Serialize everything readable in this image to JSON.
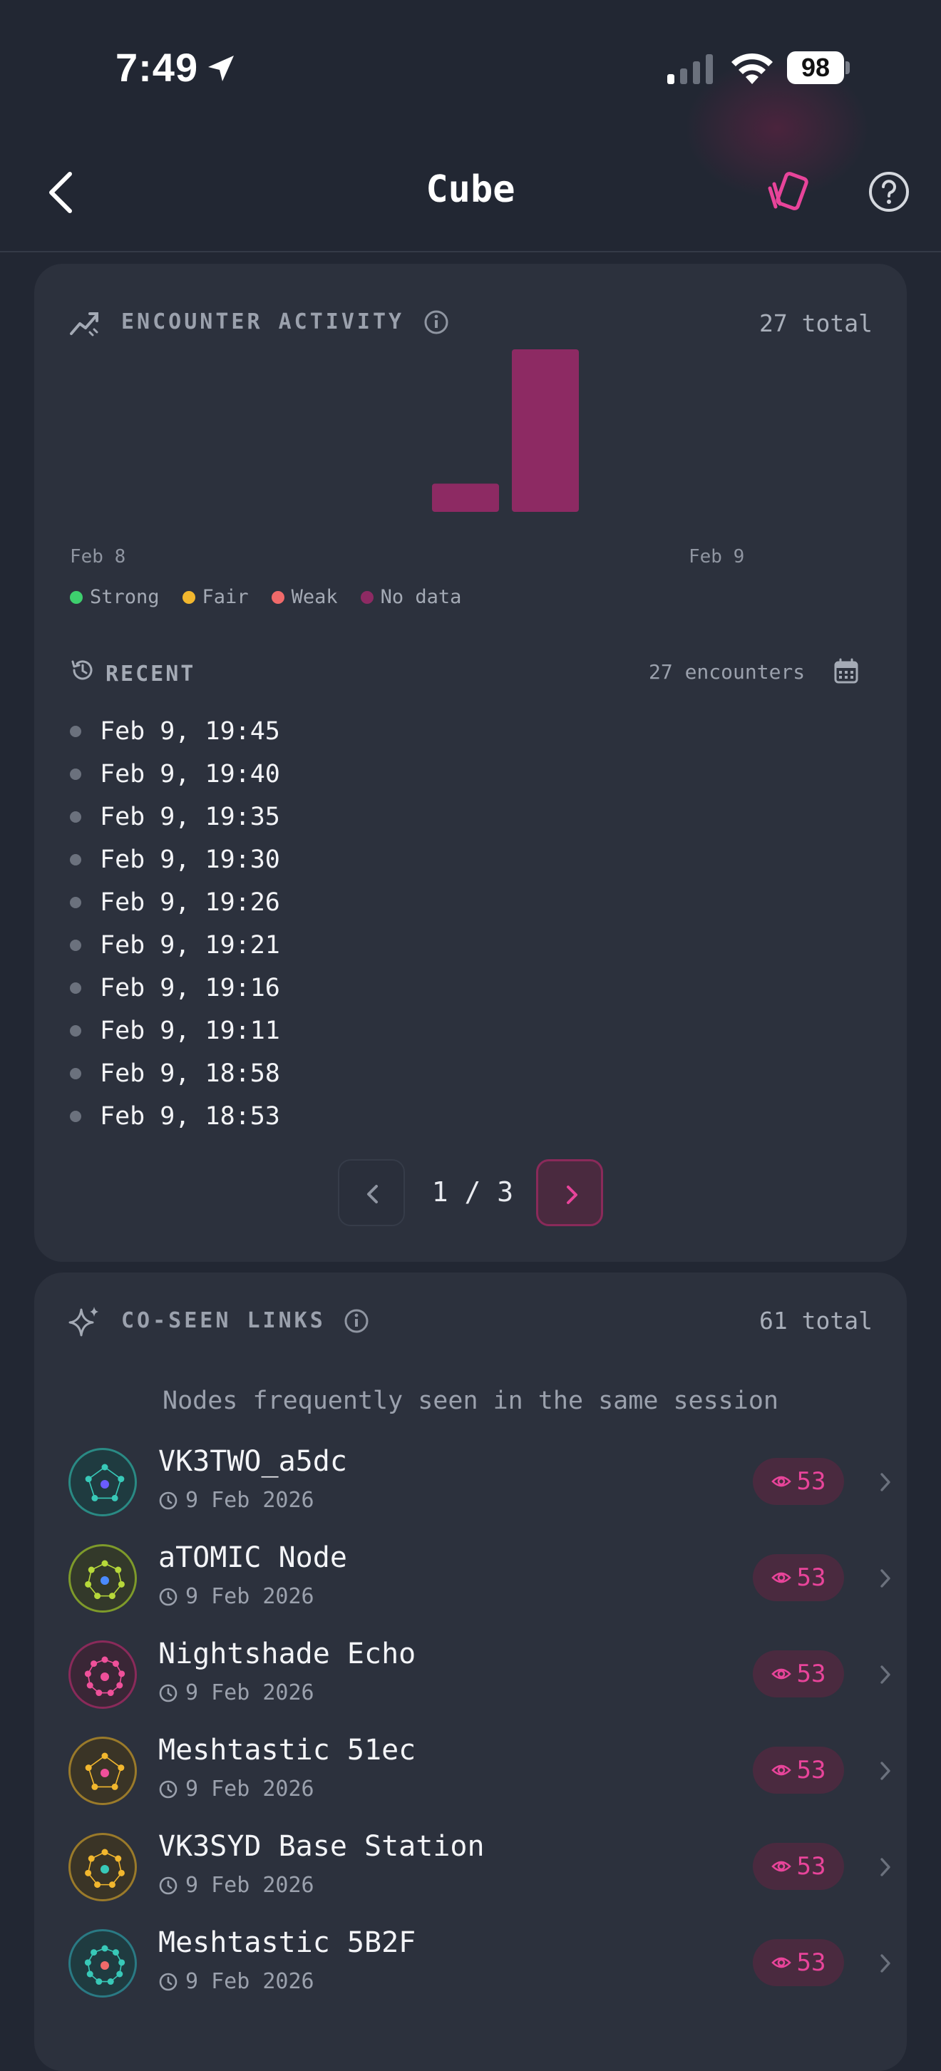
{
  "status": {
    "time": "7:49",
    "battery": "98"
  },
  "nav": {
    "title": "Cube"
  },
  "activity": {
    "title": "ENCOUNTER ACTIVITY",
    "total": "27 total",
    "date_start": "Feb 8",
    "date_end": "Feb 9",
    "legend": [
      {
        "label": "Strong",
        "color": "#3ecf6e"
      },
      {
        "label": "Fair",
        "color": "#f2b72e"
      },
      {
        "label": "Weak",
        "color": "#f06a6a"
      },
      {
        "label": "No data",
        "color": "#8d2a63"
      }
    ]
  },
  "chart_data": {
    "type": "bar",
    "categories": [
      "1",
      "2"
    ],
    "series": [
      {
        "values": [
          4,
          23
        ]
      }
    ],
    "ylim": [
      0,
      23
    ],
    "color": "#8d2a63",
    "xlabel": "",
    "ylabel": ""
  },
  "recent": {
    "title": "RECENT",
    "count": "27 encounters",
    "items": [
      "Feb 9, 19:45",
      "Feb 9, 19:40",
      "Feb 9, 19:35",
      "Feb 9, 19:30",
      "Feb 9, 19:26",
      "Feb 9, 19:21",
      "Feb 9, 19:16",
      "Feb 9, 19:11",
      "Feb 9, 18:58",
      "Feb 9, 18:53"
    ],
    "page": "1 / 3"
  },
  "coseen": {
    "title": "CO-SEEN LINKS",
    "total": "61 total",
    "subtitle": "Nodes frequently seen in the same session",
    "items": [
      {
        "name": "VK3TWO_a5dc",
        "date": "9 Feb 2026",
        "count": "53",
        "ring": "#2a8a84",
        "bg": "#1f3b40",
        "dot": "#38c9b8",
        "dot2": "#6a5cff"
      },
      {
        "name": "aTOMIC Node",
        "date": "9 Feb 2026",
        "count": "53",
        "ring": "#7e9a2a",
        "bg": "#33392a",
        "dot": "#b7d93a",
        "dot2": "#4a8bff"
      },
      {
        "name": "Nightshade Echo",
        "date": "9 Feb 2026",
        "count": "53",
        "ring": "#8a2a5a",
        "bg": "#3a2636",
        "dot": "#f0509a",
        "dot2": "#f0509a"
      },
      {
        "name": "Meshtastic 51ec",
        "date": "9 Feb 2026",
        "count": "53",
        "ring": "#9a7a2a",
        "bg": "#3a3426",
        "dot": "#f2b72e",
        "dot2": "#f0509a"
      },
      {
        "name": "VK3SYD Base Station",
        "date": "9 Feb 2026",
        "count": "53",
        "ring": "#9a7a2a",
        "bg": "#3a3426",
        "dot": "#f2b72e",
        "dot2": "#38c9b8"
      },
      {
        "name": "Meshtastic 5B2F",
        "date": "9 Feb 2026",
        "count": "53",
        "ring": "#2a7a84",
        "bg": "#1f3b40",
        "dot": "#38c9b8",
        "dot2": "#f06a6a"
      }
    ]
  }
}
